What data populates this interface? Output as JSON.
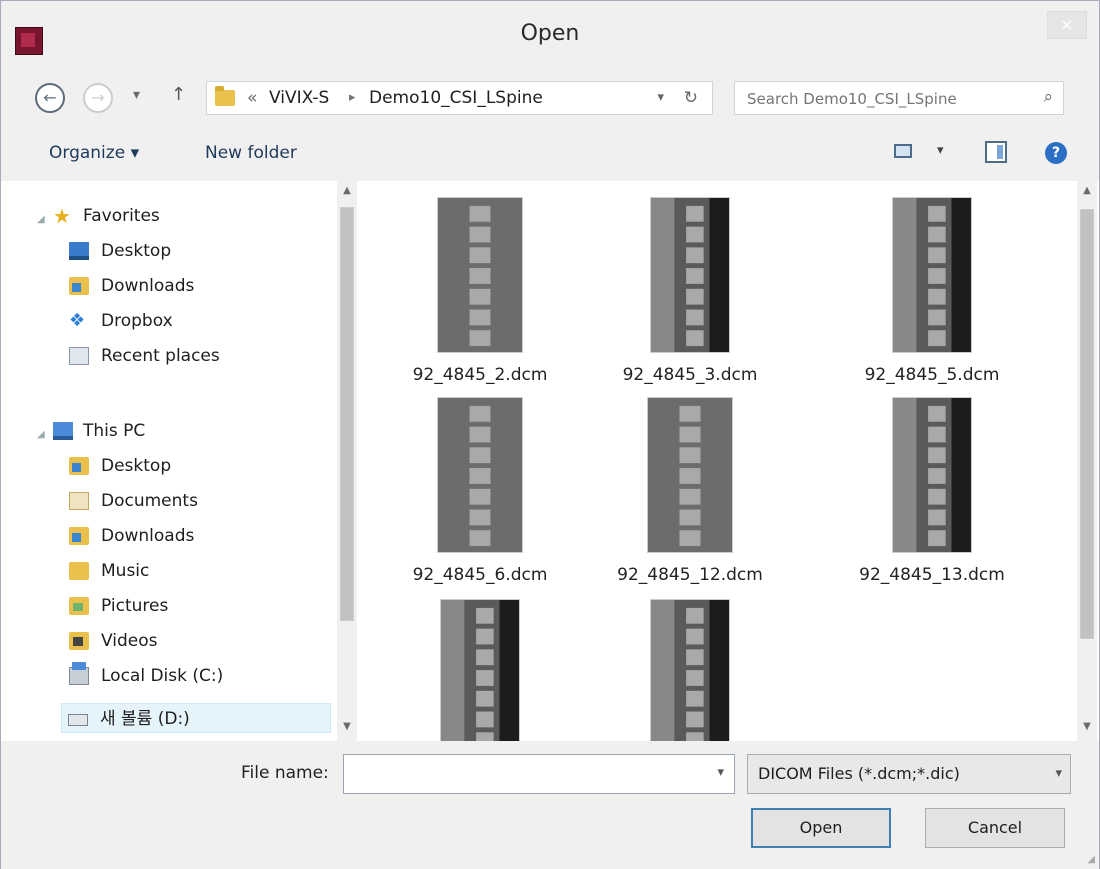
{
  "window": {
    "title": "Open",
    "close_label": "×"
  },
  "navigation": {
    "back_icon": "back-arrow-icon",
    "forward_icon": "forward-arrow-icon",
    "recent_icon": "chevron-down-icon",
    "up_icon": "up-arrow-icon",
    "breadcrumb": [
      "«",
      "ViVIX-S",
      "Demo10_CSI_LSpine"
    ],
    "search_placeholder": "Search Demo10_CSI_LSpine"
  },
  "toolbar": {
    "organize_label": "Organize ▾",
    "new_folder_label": "New folder",
    "help_label": "?"
  },
  "sidebar": {
    "items": [
      {
        "label": "Favorites",
        "icon": "star-icon"
      },
      {
        "label": "Desktop",
        "icon": "desktop-icon"
      },
      {
        "label": "Downloads",
        "icon": "downloads-folder-icon"
      },
      {
        "label": "Dropbox",
        "icon": "dropbox-icon"
      },
      {
        "label": "Recent places",
        "icon": "recent-places-icon"
      },
      {
        "label": "This PC",
        "icon": "computer-icon"
      },
      {
        "label": "Desktop",
        "icon": "desktop-folder-icon"
      },
      {
        "label": "Documents",
        "icon": "documents-folder-icon"
      },
      {
        "label": "Downloads",
        "icon": "downloads-folder-icon"
      },
      {
        "label": "Music",
        "icon": "music-folder-icon"
      },
      {
        "label": "Pictures",
        "icon": "pictures-folder-icon"
      },
      {
        "label": "Videos",
        "icon": "videos-folder-icon"
      },
      {
        "label": "Local Disk (C:)",
        "icon": "local-disk-icon"
      },
      {
        "label": "새 볼륨 (D:)",
        "icon": "drive-icon"
      }
    ]
  },
  "files": [
    {
      "name": "92_4845_2.dcm",
      "view": "ap"
    },
    {
      "name": "92_4845_3.dcm",
      "view": "lat"
    },
    {
      "name": "92_4845_5.dcm",
      "view": "lat"
    },
    {
      "name": "92_4845_6.dcm",
      "view": "ap"
    },
    {
      "name": "92_4845_12.dcm",
      "view": "ap"
    },
    {
      "name": "92_4845_13.dcm",
      "view": "lat"
    },
    {
      "name": "",
      "view": "lat"
    },
    {
      "name": "",
      "view": "lat"
    }
  ],
  "footer": {
    "file_name_label": "File name:",
    "file_name_value": "",
    "filter_value": "DICOM Files (*.dcm;*.dic)",
    "open_label": "Open",
    "cancel_label": "Cancel"
  }
}
